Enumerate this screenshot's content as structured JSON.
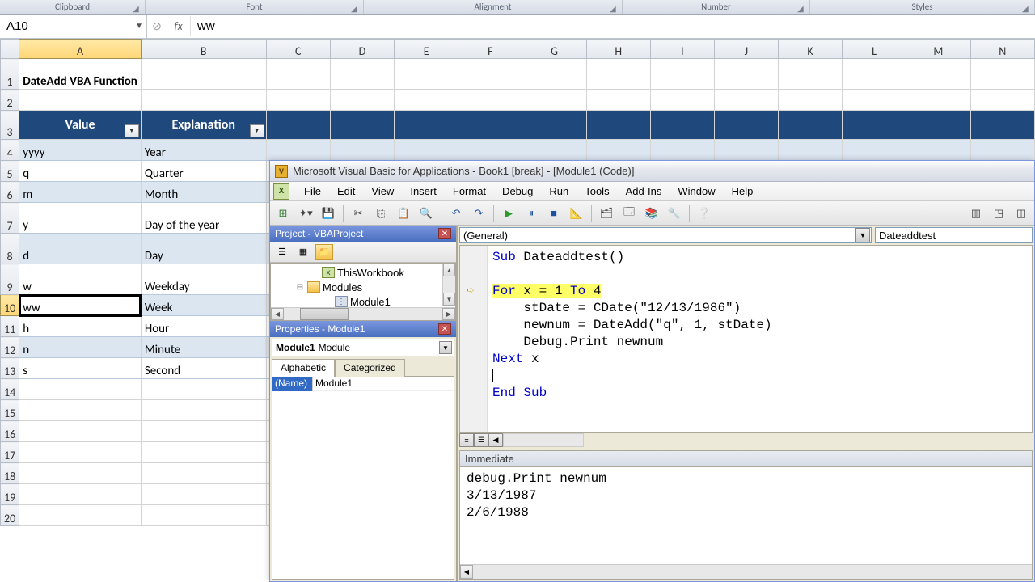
{
  "ribbon": {
    "groups": [
      "Clipboard",
      "Font",
      "Alignment",
      "Number",
      "Styles"
    ],
    "widths": [
      180,
      270,
      320,
      232,
      278
    ]
  },
  "nameBox": "A10",
  "formulaValue": "ww",
  "fxLabel": "fx",
  "columns": [
    "A",
    "B",
    "C",
    "D",
    "E",
    "F",
    "G",
    "H",
    "I",
    "J",
    "K",
    "L",
    "M",
    "N"
  ],
  "rowStart": 1,
  "rowEnd": 20,
  "selectedCell": {
    "col": "A",
    "row": 10
  },
  "title": "DateAdd VBA Function",
  "table": {
    "headers": [
      "Value",
      "Explanation"
    ],
    "rows": [
      {
        "v": "yyyy",
        "e": "Year"
      },
      {
        "v": "q",
        "e": "Quarter"
      },
      {
        "v": "m",
        "e": "Month"
      },
      {
        "v": "y",
        "e": "Day of the year"
      },
      {
        "v": "d",
        "e": "Day"
      },
      {
        "v": "w",
        "e": "Weekday"
      },
      {
        "v": "ww",
        "e": "Week"
      },
      {
        "v": "h",
        "e": "Hour"
      },
      {
        "v": "n",
        "e": "Minute"
      },
      {
        "v": "s",
        "e": "Second"
      }
    ]
  },
  "vbe": {
    "title": "Microsoft Visual Basic for Applications - Book1 [break] - [Module1 (Code)]",
    "menus": [
      "File",
      "Edit",
      "View",
      "Insert",
      "Format",
      "Debug",
      "Run",
      "Tools",
      "Add-Ins",
      "Window",
      "Help"
    ],
    "project": {
      "title": "Project - VBAProject",
      "items": {
        "workbook": "ThisWorkbook",
        "folder": "Modules",
        "module": "Module1"
      }
    },
    "properties": {
      "title": "Properties - Module1",
      "objName": "Module1",
      "objType": "Module",
      "tabs": [
        "Alphabetic",
        "Categorized"
      ],
      "nameLabel": "(Name)",
      "nameValue": "Module1"
    },
    "code": {
      "leftCombo": "(General)",
      "rightCombo": "Dateaddtest",
      "lines": [
        {
          "t": "Sub Dateaddtest()",
          "kw": [
            "Sub"
          ]
        },
        {
          "t": ""
        },
        {
          "t": "For x = 1 To 4",
          "hl": true,
          "kw": [
            "For",
            "To"
          ],
          "arrow": true
        },
        {
          "t": "    stDate = CDate(\"12/13/1986\")"
        },
        {
          "t": "    newnum = DateAdd(\"q\", 1, stDate)"
        },
        {
          "t": "    Debug.Print newnum"
        },
        {
          "t": "Next x",
          "kw": [
            "Next"
          ]
        },
        {
          "t": "",
          "cursor": true
        },
        {
          "t": "End Sub",
          "kw": [
            "End",
            "Sub"
          ]
        }
      ]
    },
    "immediate": {
      "title": "Immediate",
      "lines": [
        "debug.Print newnum",
        "3/13/1987",
        "2/6/1988"
      ]
    }
  }
}
